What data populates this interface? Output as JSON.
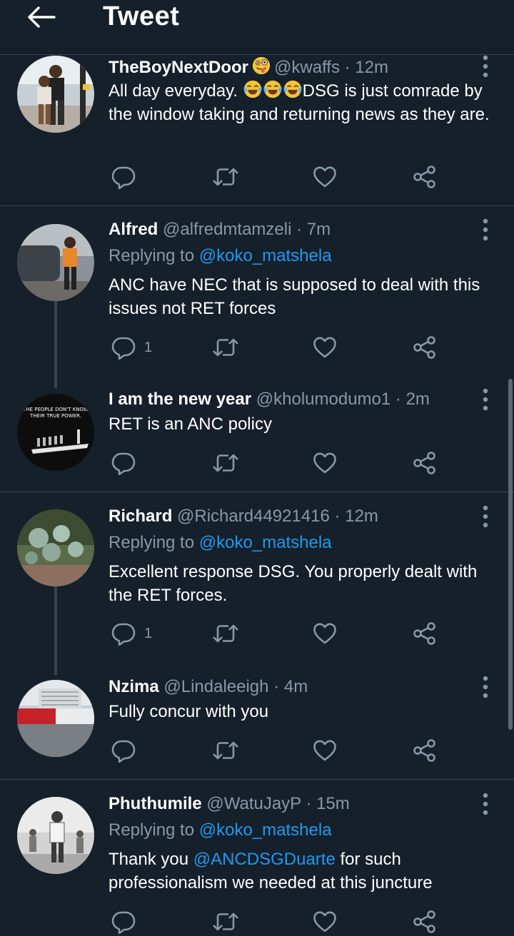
{
  "header": {
    "title": "Tweet"
  },
  "tweets": [
    {
      "name": "TheBoyNextDoor",
      "handle": "@kwaffs",
      "separator": "·",
      "time": "12m",
      "text_pre": "All day everyday. ",
      "text_post": "DSG is just comrade by the window taking and returning news as they are.",
      "text_emojis": [
        "tears-of-joy",
        "tears-of-joy",
        "tears-of-joy"
      ],
      "name_emoji": "winking-tongue-face",
      "actions": {
        "reply_count": "",
        "retweet_count": "",
        "like_count": ""
      }
    },
    {
      "name": "Alfred",
      "handle": "@alfredmtamzeli",
      "separator": "·",
      "time": "7m",
      "replying_prefix": "Replying to ",
      "replying_to": "@koko_matshela",
      "text": "ANC have NEC that is supposed to deal with this issues not RET forces",
      "actions": {
        "reply_count": "1"
      }
    },
    {
      "name": "I am the new year",
      "handle": "@kholumodumo1",
      "separator": "·",
      "time": "2m",
      "text": "RET is an ANC policy",
      "avatar_text": [
        "THE PEOPLE DON'T KNOW",
        "THEIR TRUE POWER."
      ],
      "actions": {
        "reply_count": ""
      }
    },
    {
      "name": "Richard",
      "handle": "@Richard44921416",
      "separator": "·",
      "time": "12m",
      "replying_prefix": "Replying to ",
      "replying_to": "@koko_matshela",
      "text": "Excellent response DSG. You properly dealt with the RET forces.",
      "actions": {
        "reply_count": "1"
      }
    },
    {
      "name": "Nzima",
      "handle": "@Lindaleeigh",
      "separator": "·",
      "time": "4m",
      "text": "Fully concur with you",
      "actions": {
        "reply_count": ""
      }
    },
    {
      "name": "Phuthumile",
      "handle": "@WatuJayP",
      "separator": "·",
      "time": "15m",
      "replying_prefix": "Replying to ",
      "replying_to": "@koko_matshela",
      "text_prefix": "Thank you ",
      "text_mention": "@ANCDSGDuarte",
      "text_suffix": " for such professionalism we needed at this juncture",
      "actions": {
        "reply_count": ""
      }
    }
  ],
  "icons": {
    "back": "arrow-left-icon",
    "more": "vertical-dots-icon",
    "reply": "speech-bubble-icon",
    "retweet": "retweet-arrows-icon",
    "like": "heart-icon",
    "share": "share-nodes-icon"
  },
  "colors": {
    "background": "#15202b",
    "divider": "#38444d",
    "secondary_text": "#8899a6",
    "link": "#1d9bf0",
    "primary_text": "#ffffff"
  }
}
